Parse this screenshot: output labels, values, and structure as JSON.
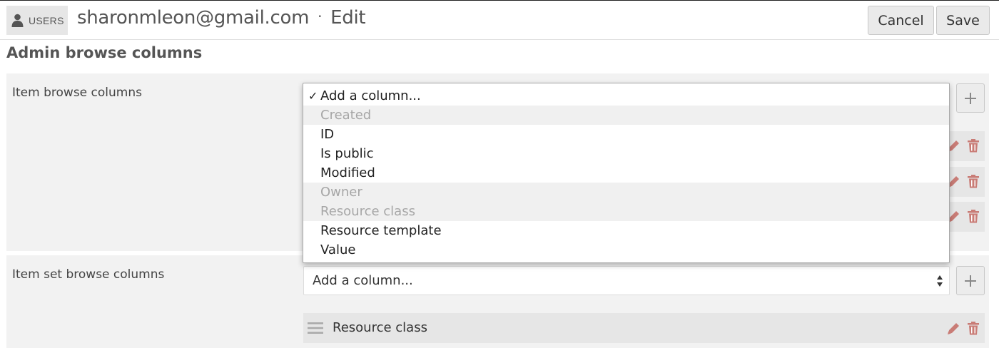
{
  "header": {
    "badge_label": "USERS",
    "badge_icon": "person-icon",
    "title_email": "sharonmleon@gmail.com",
    "title_separator": "·",
    "title_action": "Edit",
    "cancel_label": "Cancel",
    "save_label": "Save"
  },
  "section": {
    "title": "Admin browse columns"
  },
  "item_browse": {
    "label": "Item browse columns",
    "dropdown": {
      "check_mark": "✓",
      "options": [
        {
          "label": "Add a column...",
          "selected": true,
          "disabled": false
        },
        {
          "label": "Created",
          "selected": false,
          "disabled": true
        },
        {
          "label": "ID",
          "selected": false,
          "disabled": false
        },
        {
          "label": "Is public",
          "selected": false,
          "disabled": false
        },
        {
          "label": "Modified",
          "selected": false,
          "disabled": false
        },
        {
          "label": "Owner",
          "selected": false,
          "disabled": true
        },
        {
          "label": "Resource class",
          "selected": false,
          "disabled": true
        },
        {
          "label": "Resource template",
          "selected": false,
          "disabled": false
        },
        {
          "label": "Value",
          "selected": false,
          "disabled": false
        }
      ]
    }
  },
  "item_set_browse": {
    "label": "Item set browse columns",
    "select_value": "Add a column...",
    "rows": [
      {
        "label": "Resource class"
      }
    ]
  },
  "colors": {
    "action_icon": "#c97c76",
    "badge_bg": "#e6e6e6",
    "panel_bg": "#f2f2f2"
  }
}
